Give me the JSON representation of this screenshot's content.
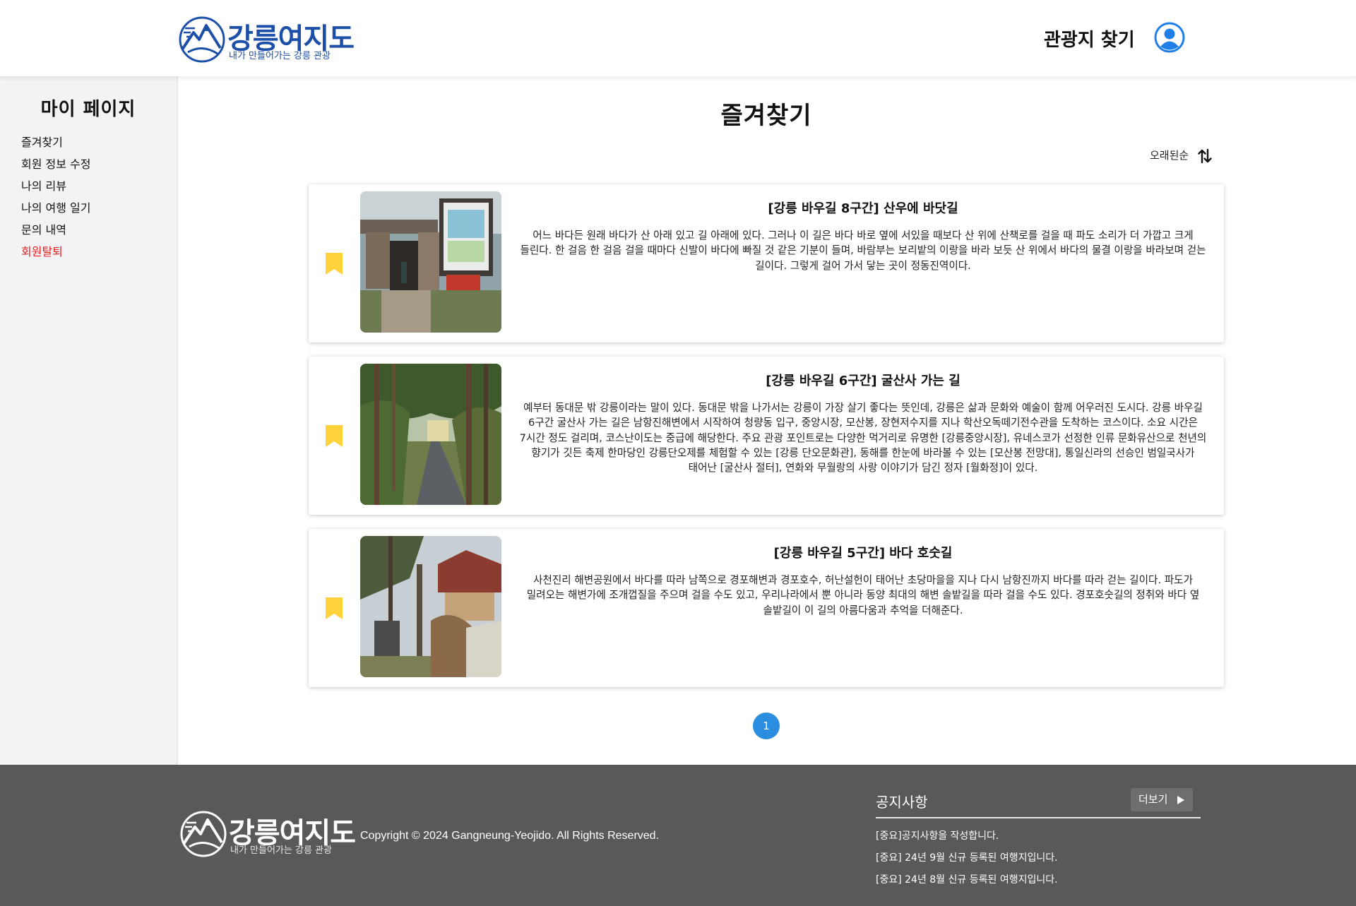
{
  "header": {
    "logo_name": "강릉여지도",
    "logo_slogan": "내가 만들어가는 강릉 관광",
    "nav_link": "관광지 찾기"
  },
  "sidebar": {
    "title": "마이 페이지",
    "items": [
      {
        "label": "즐겨찾기"
      },
      {
        "label": "회원 정보 수정"
      },
      {
        "label": "나의 리뷰"
      },
      {
        "label": "나의 여행 일기"
      },
      {
        "label": "문의 내역"
      },
      {
        "label": "회원탈퇴"
      }
    ]
  },
  "main": {
    "title": "즐겨찾기",
    "sort_label": "오래된순",
    "cards": [
      {
        "title": "[강릉 바우길 8구간] 산우에 바닷길",
        "description": "어느 바다든 원래 바다가 산 아래 있고 길 아래에 있다. 그러나 이 길은 바다 바로 옆에 서있을 때보다 산 위에 산책로를 걸을 때 파도 소리가 더 가깝고 크게 들린다. 한 걸음 한 걸음 걸을 때마다 신발이 바다에 빠질 것 같은 기분이 들며, 바람부는 보리밭의 이랑을 바라 보듯 산 위에서 바다의 물결 이랑을 바라보며 걷는 길이다. 그렇게 걸어 가서 닿는 곳이 정동진역이다."
      },
      {
        "title": "[강릉 바우길 6구간] 굴산사 가는 길",
        "description": "예부터 동대문 밖 강릉이라는 말이 있다. 동대문 밖을 나가서는 강릉이 가장 살기 좋다는 뜻인데, 강릉은 삶과 문화와 예술이 함께 어우러진 도시다. 강릉 바우길 6구간 굴산사 가는 길은 남항진해변에서 시작하여 청량동 입구, 중앙시장, 모산봉, 장현저수지를 지나 학산오독떼기전수관을 도착하는 코스이다. 소요 시간은 7시간 정도 걸리며, 코스난이도는 중급에 해당한다. 주요 관광 포인트로는 다양한 먹거리로 유명한 [강릉중앙시장], 유네스코가 선정한 인류 문화유산으로 천년의 향기가 깃든 축제 한마당인 강릉단오제를 체험할 수 있는 [강릉 단오문화관], 동해를 한눈에 바라볼 수 있는 [모산봉 전망대], 통일신라의 선승인 범일국사가 태어난 [굴산사 절터], 연화와 무월랑의 사랑 이야기가 담긴 정자 [월화정]이 있다."
      },
      {
        "title": "[강릉 바우길 5구간] 바다 호숫길",
        "description": "사천진리 해변공원에서 바다를 따라 남쪽으로 경포해변과 경포호수, 허난설헌이 태어난 초당마을을 지나 다시 남항진까지 바다를 따라 걷는 길이다. 파도가 밀려오는 해변가에 조개껍질을 주으며 걸을 수도 있고, 우리나라에서 뿐 아니라 동양 최대의 해변 솔밭길을 따라 걸을 수도 있다. 경포호숫길의 정취와 바다 옆 솔밭길이 이 길의 아름다움과 추억을 더해준다."
      }
    ],
    "pagination": {
      "current": "1"
    }
  },
  "footer": {
    "copyright": "Copyright © 2024 Gangneung-Yeojido. All Rights Reserved.",
    "notice_title": "공지사항",
    "more_label": "더보기",
    "notices": [
      {
        "text": "[중요]공지사항을 작성합니다."
      },
      {
        "text": "[중요] 24년 9월 신규 등록된 여행지입니다."
      },
      {
        "text": "[중요] 24년 8월 신규 등록된 여행지입니다."
      }
    ]
  },
  "colors": {
    "brand": "#1b4fa8",
    "user_icon": "#1f7ee8",
    "bookmark": "#ffd23a",
    "danger": "#e8201d",
    "pager": "#2b8de0",
    "footer_bg": "#595959"
  }
}
